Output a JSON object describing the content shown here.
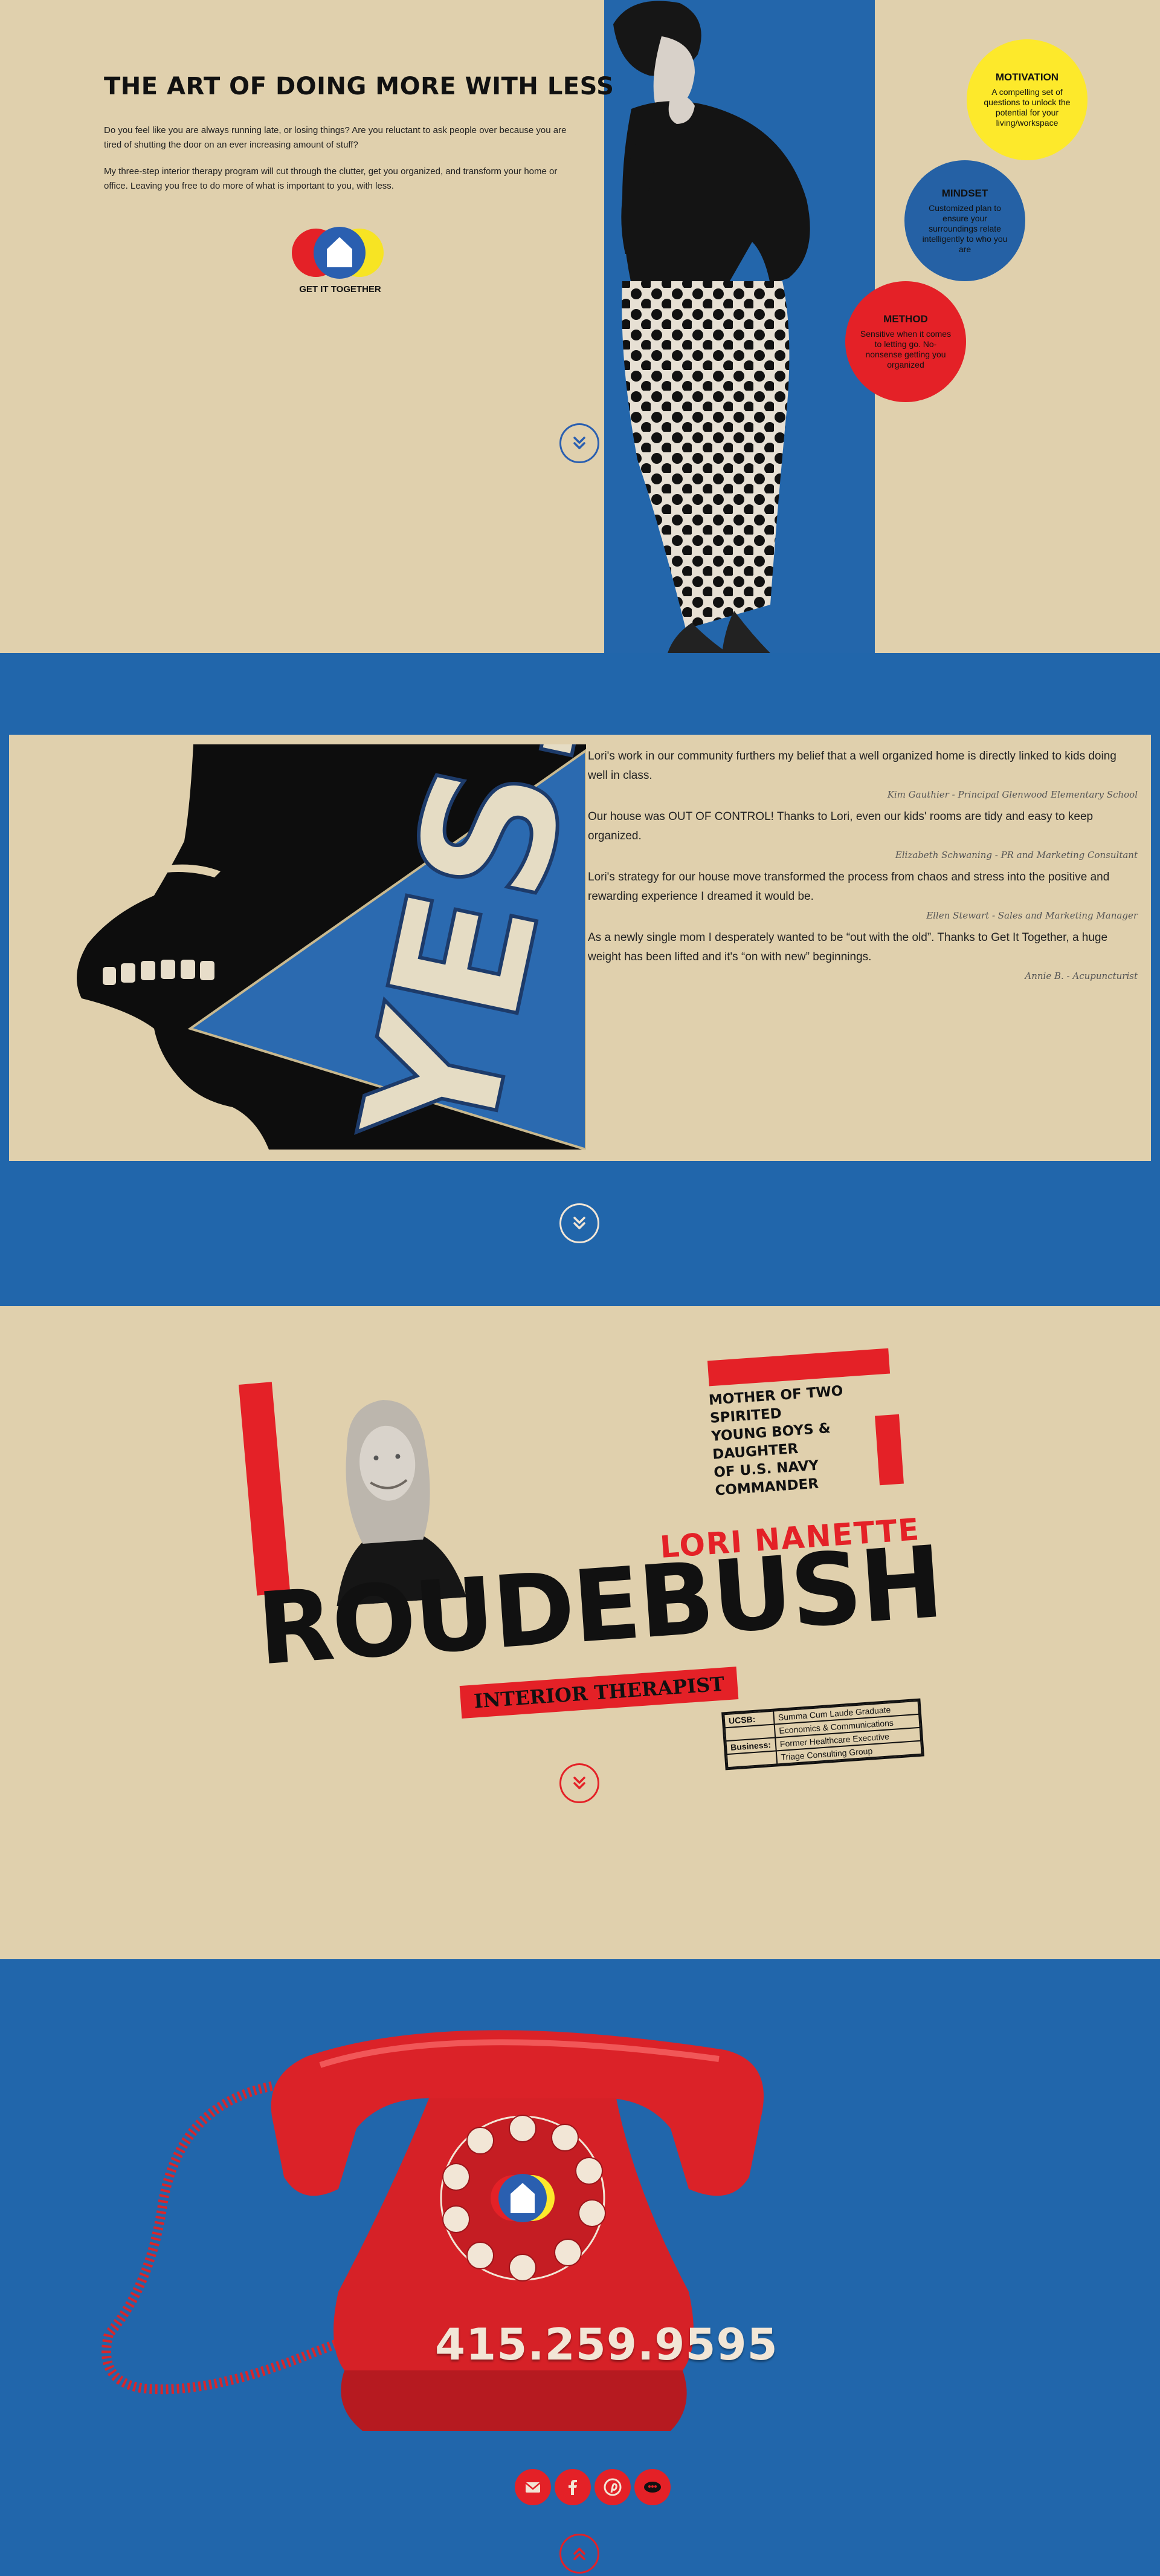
{
  "hero": {
    "headline": "THE ART OF DOING MORE WITH LESS",
    "para1": "Do you feel like you are always running late, or losing things? Are you reluctant to ask people over because you are tired of shutting the door on an ever increasing amount of stuff?",
    "para2": "My three-step interior therapy program will cut through the clutter, get you organized, and transform your home or office. Leaving you free to do more of what is important to you, with less.",
    "logo_text": "GET IT TOGETHER",
    "bubbles": [
      {
        "title": "MOTIVATION",
        "text": "A compelling set of questions to unlock the potential for your living/workspace"
      },
      {
        "title": "MINDSET",
        "text": "Customized plan to ensure your surroundings relate intelligently to who you are"
      },
      {
        "title": "METHOD",
        "text": "Sensitive when it comes to letting go. No-nonsense getting you organized"
      }
    ]
  },
  "testimonials": {
    "art_text": "YES!",
    "items": [
      {
        "quote": "Lori's work in our community furthers my belief that a well organized home is directly linked to kids doing well in class.",
        "author": "Kim Gauthier - Principal Glenwood Elementary School"
      },
      {
        "quote": "Our house was OUT OF CONTROL! Thanks to Lori, even our kids' rooms are tidy and easy to keep organized.",
        "author": "Elizabeth Schwaning - PR and Marketing Consultant"
      },
      {
        "quote": "Lori's strategy for our house move transformed the process from chaos and stress into the positive and rewarding experience I dreamed it would be.",
        "author": "Ellen Stewart - Sales and Marketing Manager"
      },
      {
        "quote": "As a newly single mom I desperately wanted to be “out with the old”. Thanks to Get It Together, a huge weight has been lifted and it's “on with new” beginnings.",
        "author": "Annie B. - Acupuncturist"
      }
    ]
  },
  "about": {
    "mother_line1": "MOTHER OF TWO SPIRITED",
    "mother_line2": "YOUNG BOYS & DAUGHTER",
    "mother_line3": "OF U.S. NAVY COMMANDER",
    "first_name": "LORI NANETTE",
    "last_name": "ROUDEBUSH",
    "title": "INTERIOR THERAPIST",
    "creds": [
      {
        "key": "UCSB:",
        "value": "Summa Cum Laude Graduate"
      },
      {
        "key": "",
        "value": "Economics & Communications"
      },
      {
        "key": "Business:",
        "value": "Former Healthcare Executive"
      },
      {
        "key": "",
        "value": "Triage Consulting Group"
      }
    ]
  },
  "contact": {
    "phone": "415.259.9595",
    "socials": [
      "email-icon",
      "facebook-icon",
      "pinterest-icon",
      "yelp-icon"
    ]
  },
  "colors": {
    "tan": "#e0d0ad",
    "blue": "#2166ab",
    "red": "#e42127",
    "yellow": "#fde92b"
  }
}
